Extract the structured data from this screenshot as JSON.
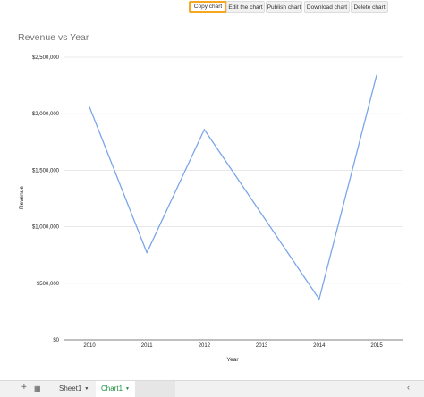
{
  "toolbar": {
    "copy_label": "Copy chart",
    "edit_label": "Edit the chart",
    "publish_label": "Publish chart",
    "download_label": "Download chart",
    "delete_label": "Delete chart",
    "highlight_color": "#f5a623"
  },
  "chart_data": {
    "type": "line",
    "title": "Revenue vs Year",
    "xlabel": "Year",
    "ylabel": "Revenue",
    "categories": [
      "2010",
      "2011",
      "2012",
      "2013",
      "2014",
      "2015"
    ],
    "series": [
      {
        "values": [
          2060000,
          770000,
          1860000,
          null,
          360000,
          2340000
        ],
        "color": "#7aa6e8"
      }
    ],
    "ylim": [
      0,
      2500000
    ],
    "yticks": [
      0,
      500000,
      1000000,
      1500000,
      2000000,
      2500000
    ],
    "ytick_labels": [
      "$0",
      "$500,000",
      "$1,000,000",
      "$1,500,000",
      "$2,000,000",
      "$2,500,000"
    ],
    "grid": true,
    "legend": "none"
  },
  "tabs": {
    "add_icon": "plus-icon",
    "menu_icon": "all-sheets-icon",
    "sheets": [
      {
        "label": "Sheet1",
        "active": false
      },
      {
        "label": "Chart1",
        "active": true
      }
    ],
    "scroll_icon": "chevron-left-icon",
    "active_color": "#1e8e3e"
  }
}
